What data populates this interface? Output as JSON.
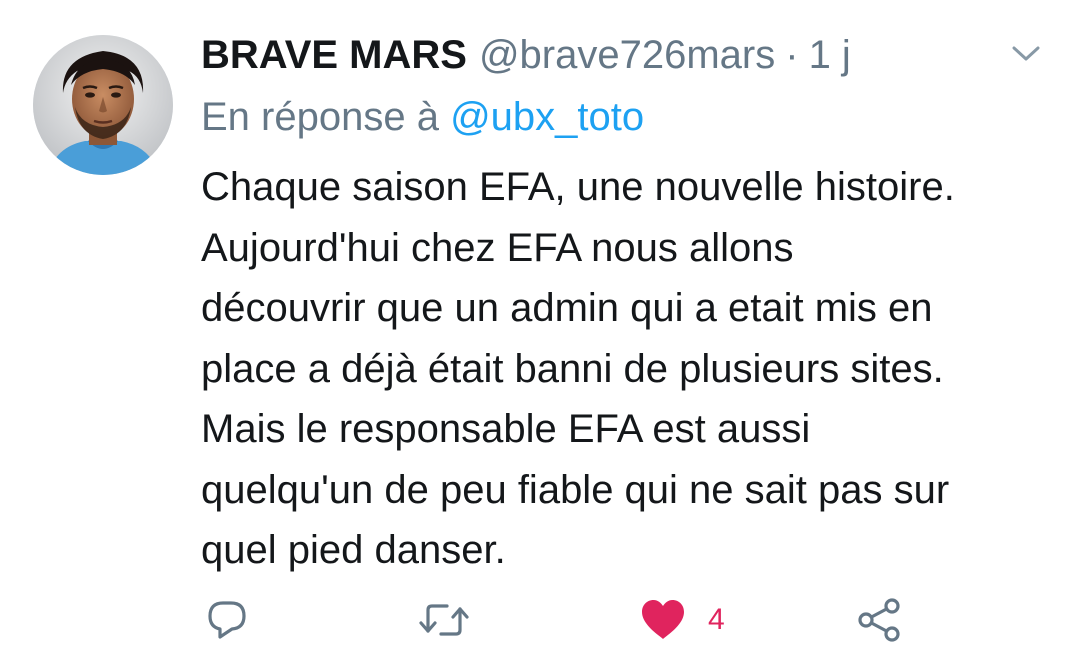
{
  "tweet": {
    "display_name": "BRAVE MARS",
    "handle": "@brave726mars",
    "separator": "·",
    "time": "1 j",
    "reply_prefix": "En réponse à",
    "reply_target": "@ubx_toto",
    "body_lines": [
      "Chaque saison EFA, une nouvelle histoire.",
      "Aujourd'hui chez EFA nous allons",
      "découvrir que un admin qui a etait mis en",
      "place a déjà était banni de plusieurs sites.",
      "Mais le responsable EFA est aussi",
      "quelqu'un de peu fiable qui ne sait pas sur",
      "quel pied danser."
    ],
    "like_count": "4"
  },
  "icons": {
    "avatar": "avatar-player-face",
    "caret": "chevron-down-icon",
    "reply": "reply-bubble-icon",
    "retweet": "retweet-icon",
    "like": "heart-filled-icon",
    "share": "share-icon"
  },
  "colors": {
    "text": "#14171a",
    "muted": "#657786",
    "link": "#1da1f2",
    "like": "#e0245e",
    "icon": "#657786"
  }
}
